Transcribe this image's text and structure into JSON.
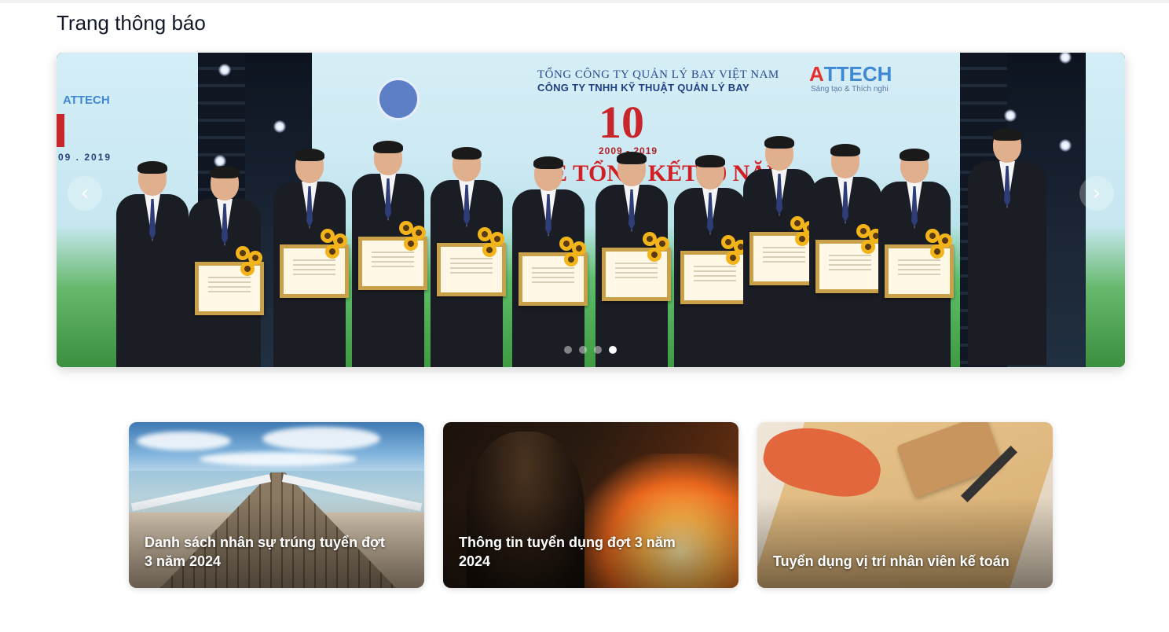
{
  "page": {
    "title": "Trang thông báo"
  },
  "carousel": {
    "slide_text": {
      "org_line1": "TỔNG CÔNG TY QUẢN LÝ BAY VIỆT NAM",
      "org_line2": "CÔNG TY TNHH KỸ THUẬT QUẢN LÝ BAY",
      "logo_letter": "A",
      "logo_rest": "TTECH",
      "logo_tagline": "Sáng tạo & Thích nghi",
      "anniversary": "10",
      "years": "2009 - 2019",
      "headline": "LỄ TỔNG KẾT 10 NĂM",
      "left_logo": "ATTECH",
      "left_years": "09 . 2019"
    },
    "prev_icon": "chevron-left-icon",
    "next_icon": "chevron-right-icon",
    "prev_glyph": "‹",
    "next_glyph": "›",
    "dots_count": 4,
    "active_dot": 3
  },
  "cards": [
    {
      "title": "Danh sách nhân sự trúng tuyển đợt 3 năm 2024",
      "image": "pier-photo"
    },
    {
      "title": "Thông tin tuyển dụng đợt 3 năm 2024",
      "image": "fire-night-photo"
    },
    {
      "title": "Tuyển dụng vị trí nhân viên kế toán",
      "image": "desk-photo"
    }
  ],
  "colors": {
    "title": "#111827",
    "accent_red": "#c8262a",
    "accent_blue": "#3e88d4"
  }
}
